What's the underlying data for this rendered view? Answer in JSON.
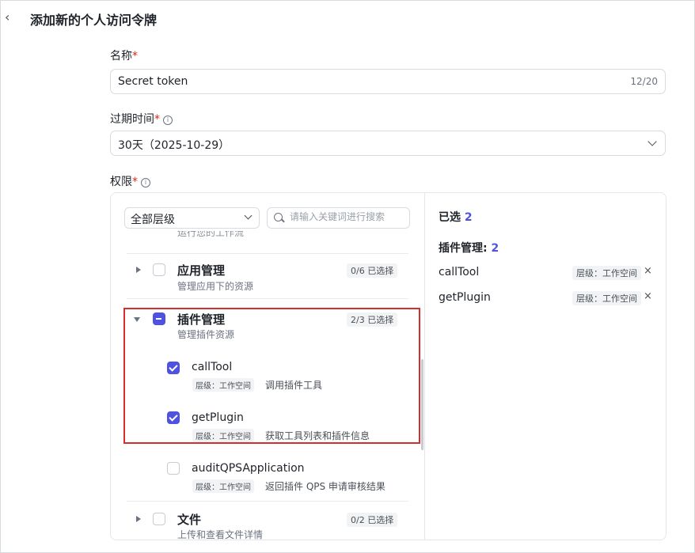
{
  "header": {
    "back_icon": "chevron-left-icon",
    "title": "添加新的个人访问令牌"
  },
  "name_field": {
    "label": "名称",
    "required_mark": "*",
    "value": "Secret token",
    "counter": "12/20"
  },
  "expiry_field": {
    "label": "过期时间",
    "required_mark": "*",
    "value": "30天（2025-10-29）"
  },
  "permissions": {
    "label": "权限",
    "required_mark": "*",
    "scope_select": {
      "value": "全部层级"
    },
    "search": {
      "placeholder": "请输入关键词进行搜索"
    },
    "cut_off_text": "运行您的工作流",
    "groups": [
      {
        "title": "应用管理",
        "desc": "管理应用下的资源",
        "badge": "0/6 已选择",
        "state": "unchecked",
        "expanded": false
      },
      {
        "title": "插件管理",
        "desc": "管理插件资源",
        "badge": "2/3 已选择",
        "state": "partial",
        "expanded": true,
        "items": [
          {
            "name": "callTool",
            "level": "层级：工作空间",
            "desc": "调用插件工具",
            "checked": true
          },
          {
            "name": "getPlugin",
            "level": "层级：工作空间",
            "desc": "获取工具列表和插件信息",
            "checked": true
          },
          {
            "name": "auditQPSApplication",
            "level": "层级：工作空间",
            "desc": "返回插件 QPS 申请审核结果",
            "checked": false
          }
        ]
      },
      {
        "title": "文件",
        "desc": "上传和查看文件详情",
        "badge": "0/2 已选择",
        "state": "unchecked",
        "expanded": false
      }
    ],
    "selected_panel": {
      "title": "已选",
      "count": "2",
      "group_label": "插件管理:",
      "group_count": "2",
      "items": [
        {
          "name": "callTool",
          "level": "层级：工作空间",
          "remove": "×"
        },
        {
          "name": "getPlugin",
          "level": "层级：工作空间",
          "remove": "×"
        }
      ]
    }
  },
  "colors": {
    "accent": "#4f52e0",
    "required": "#e2231a",
    "highlight_border": "#d32f2f"
  }
}
